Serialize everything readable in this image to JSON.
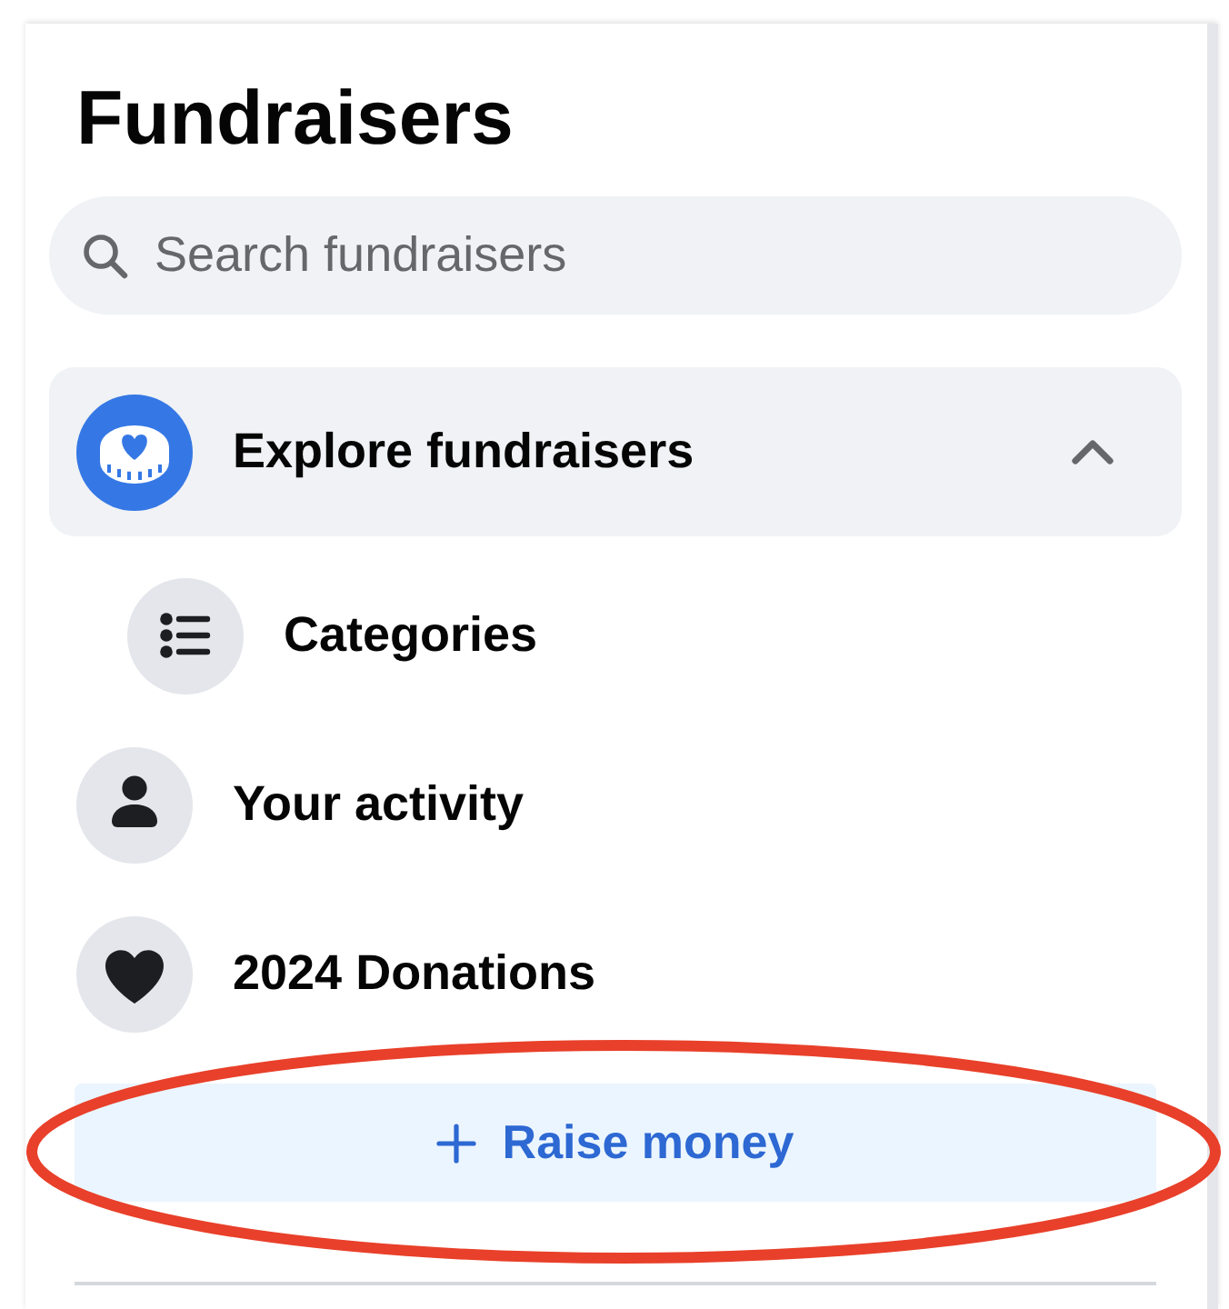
{
  "title": "Fundraisers",
  "search": {
    "placeholder": "Search fundraisers"
  },
  "nav": [
    {
      "label": "Explore fundraisers",
      "selected": true,
      "expanded": true,
      "children": [
        {
          "label": "Categories",
          "selected": false
        }
      ]
    },
    {
      "label": "Your activity",
      "selected": false
    },
    {
      "label": "2024 Donations",
      "selected": false
    }
  ],
  "raise_button": {
    "label": "Raise money",
    "highlighted": true
  }
}
